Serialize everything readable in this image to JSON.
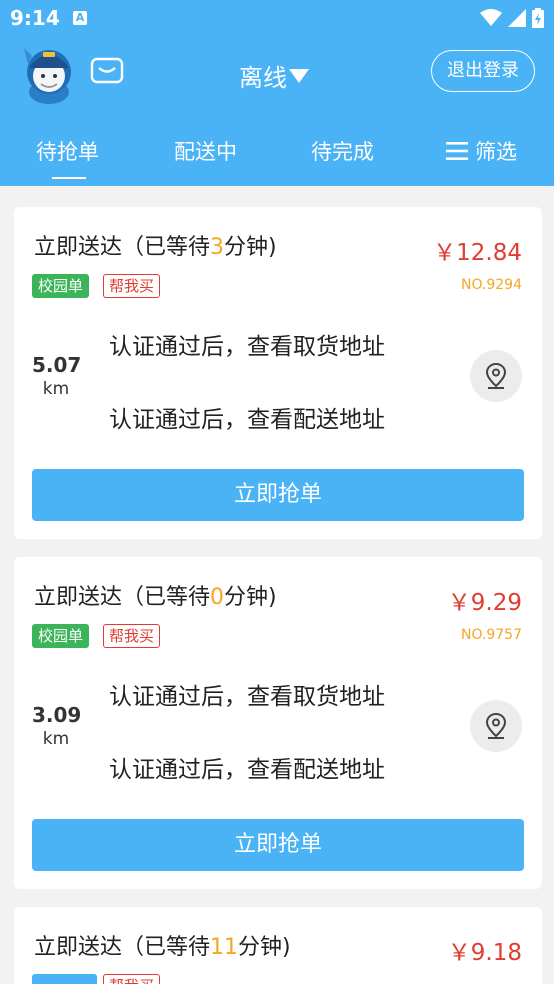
{
  "status_bar": {
    "time": "9:14",
    "a_label": "A"
  },
  "header": {
    "status_label": "离线",
    "logout_label": "退出登录"
  },
  "tabs": [
    {
      "label": "待抢单",
      "active": true
    },
    {
      "label": "配送中",
      "active": false
    },
    {
      "label": "待完成",
      "active": false
    },
    {
      "label": "筛选",
      "active": false
    }
  ],
  "orders": [
    {
      "title_prefix": "立即送达（已等待",
      "wait_minutes": "3",
      "title_suffix": "分钟)",
      "price": "￥12.84",
      "tag_campus": "校园单",
      "tag_type": "帮我买",
      "order_no": "NO.9294",
      "distance": "5.07",
      "unit": "km",
      "pickup_text": "认证通过后，查看取货地址",
      "delivery_text": "认证通过后，查看配送地址",
      "button_label": "立即抢单"
    },
    {
      "title_prefix": "立即送达（已等待",
      "wait_minutes": "0",
      "title_suffix": "分钟)",
      "price": "￥9.29",
      "tag_campus": "校园单",
      "tag_type": "帮我买",
      "order_no": "NO.9757",
      "distance": "3.09",
      "unit": "km",
      "pickup_text": "认证通过后，查看取货地址",
      "delivery_text": "认证通过后，查看配送地址",
      "button_label": "立即抢单"
    },
    {
      "title_prefix": "立即送达（已等待",
      "wait_minutes": "11",
      "title_suffix": "分钟)",
      "price": "￥9.18",
      "tag_campus": "",
      "tag_type": "帮我买",
      "order_no": "",
      "distance": "",
      "unit": "",
      "pickup_text": "",
      "delivery_text": "",
      "button_label": ""
    }
  ],
  "colors": {
    "primary": "#4ab3f6",
    "price": "#e03c31",
    "wait": "#f5a623",
    "campus_tag": "#3cb55a",
    "card_bg": "#ffffff",
    "page_bg": "#f2f2f2"
  }
}
